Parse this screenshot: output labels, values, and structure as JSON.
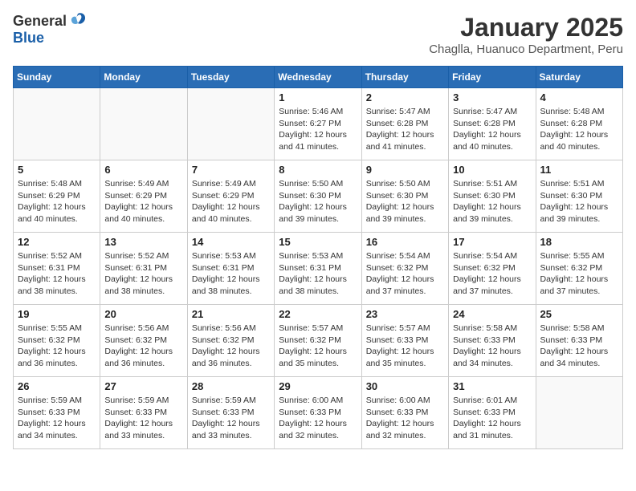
{
  "header": {
    "logo_general": "General",
    "logo_blue": "Blue",
    "month_title": "January 2025",
    "location": "Chaglla, Huanuco Department, Peru"
  },
  "days_of_week": [
    "Sunday",
    "Monday",
    "Tuesday",
    "Wednesday",
    "Thursday",
    "Friday",
    "Saturday"
  ],
  "weeks": [
    [
      {
        "day": "",
        "info": ""
      },
      {
        "day": "",
        "info": ""
      },
      {
        "day": "",
        "info": ""
      },
      {
        "day": "1",
        "info": "Sunrise: 5:46 AM\nSunset: 6:27 PM\nDaylight: 12 hours\nand 41 minutes."
      },
      {
        "day": "2",
        "info": "Sunrise: 5:47 AM\nSunset: 6:28 PM\nDaylight: 12 hours\nand 41 minutes."
      },
      {
        "day": "3",
        "info": "Sunrise: 5:47 AM\nSunset: 6:28 PM\nDaylight: 12 hours\nand 40 minutes."
      },
      {
        "day": "4",
        "info": "Sunrise: 5:48 AM\nSunset: 6:28 PM\nDaylight: 12 hours\nand 40 minutes."
      }
    ],
    [
      {
        "day": "5",
        "info": "Sunrise: 5:48 AM\nSunset: 6:29 PM\nDaylight: 12 hours\nand 40 minutes."
      },
      {
        "day": "6",
        "info": "Sunrise: 5:49 AM\nSunset: 6:29 PM\nDaylight: 12 hours\nand 40 minutes."
      },
      {
        "day": "7",
        "info": "Sunrise: 5:49 AM\nSunset: 6:29 PM\nDaylight: 12 hours\nand 40 minutes."
      },
      {
        "day": "8",
        "info": "Sunrise: 5:50 AM\nSunset: 6:30 PM\nDaylight: 12 hours\nand 39 minutes."
      },
      {
        "day": "9",
        "info": "Sunrise: 5:50 AM\nSunset: 6:30 PM\nDaylight: 12 hours\nand 39 minutes."
      },
      {
        "day": "10",
        "info": "Sunrise: 5:51 AM\nSunset: 6:30 PM\nDaylight: 12 hours\nand 39 minutes."
      },
      {
        "day": "11",
        "info": "Sunrise: 5:51 AM\nSunset: 6:30 PM\nDaylight: 12 hours\nand 39 minutes."
      }
    ],
    [
      {
        "day": "12",
        "info": "Sunrise: 5:52 AM\nSunset: 6:31 PM\nDaylight: 12 hours\nand 38 minutes."
      },
      {
        "day": "13",
        "info": "Sunrise: 5:52 AM\nSunset: 6:31 PM\nDaylight: 12 hours\nand 38 minutes."
      },
      {
        "day": "14",
        "info": "Sunrise: 5:53 AM\nSunset: 6:31 PM\nDaylight: 12 hours\nand 38 minutes."
      },
      {
        "day": "15",
        "info": "Sunrise: 5:53 AM\nSunset: 6:31 PM\nDaylight: 12 hours\nand 38 minutes."
      },
      {
        "day": "16",
        "info": "Sunrise: 5:54 AM\nSunset: 6:32 PM\nDaylight: 12 hours\nand 37 minutes."
      },
      {
        "day": "17",
        "info": "Sunrise: 5:54 AM\nSunset: 6:32 PM\nDaylight: 12 hours\nand 37 minutes."
      },
      {
        "day": "18",
        "info": "Sunrise: 5:55 AM\nSunset: 6:32 PM\nDaylight: 12 hours\nand 37 minutes."
      }
    ],
    [
      {
        "day": "19",
        "info": "Sunrise: 5:55 AM\nSunset: 6:32 PM\nDaylight: 12 hours\nand 36 minutes."
      },
      {
        "day": "20",
        "info": "Sunrise: 5:56 AM\nSunset: 6:32 PM\nDaylight: 12 hours\nand 36 minutes."
      },
      {
        "day": "21",
        "info": "Sunrise: 5:56 AM\nSunset: 6:32 PM\nDaylight: 12 hours\nand 36 minutes."
      },
      {
        "day": "22",
        "info": "Sunrise: 5:57 AM\nSunset: 6:32 PM\nDaylight: 12 hours\nand 35 minutes."
      },
      {
        "day": "23",
        "info": "Sunrise: 5:57 AM\nSunset: 6:33 PM\nDaylight: 12 hours\nand 35 minutes."
      },
      {
        "day": "24",
        "info": "Sunrise: 5:58 AM\nSunset: 6:33 PM\nDaylight: 12 hours\nand 34 minutes."
      },
      {
        "day": "25",
        "info": "Sunrise: 5:58 AM\nSunset: 6:33 PM\nDaylight: 12 hours\nand 34 minutes."
      }
    ],
    [
      {
        "day": "26",
        "info": "Sunrise: 5:59 AM\nSunset: 6:33 PM\nDaylight: 12 hours\nand 34 minutes."
      },
      {
        "day": "27",
        "info": "Sunrise: 5:59 AM\nSunset: 6:33 PM\nDaylight: 12 hours\nand 33 minutes."
      },
      {
        "day": "28",
        "info": "Sunrise: 5:59 AM\nSunset: 6:33 PM\nDaylight: 12 hours\nand 33 minutes."
      },
      {
        "day": "29",
        "info": "Sunrise: 6:00 AM\nSunset: 6:33 PM\nDaylight: 12 hours\nand 32 minutes."
      },
      {
        "day": "30",
        "info": "Sunrise: 6:00 AM\nSunset: 6:33 PM\nDaylight: 12 hours\nand 32 minutes."
      },
      {
        "day": "31",
        "info": "Sunrise: 6:01 AM\nSunset: 6:33 PM\nDaylight: 12 hours\nand 31 minutes."
      },
      {
        "day": "",
        "info": ""
      }
    ]
  ]
}
